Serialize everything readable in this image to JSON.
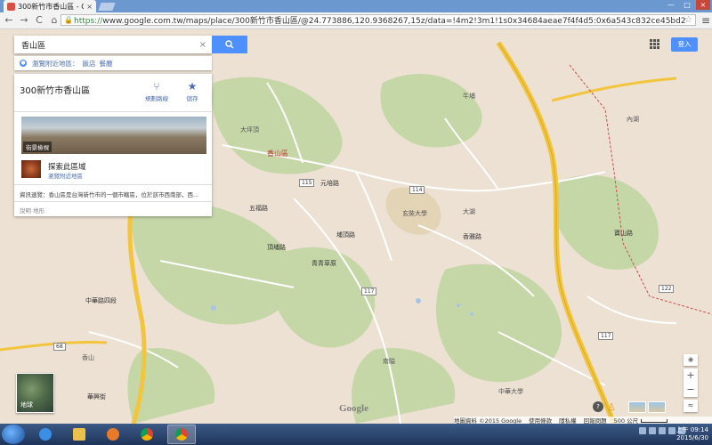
{
  "browser": {
    "tab_title": "300新竹市香山區 - Goog",
    "tab_close": "×",
    "url_scheme": "https://",
    "url_rest": "www.google.com.tw/maps/place/300新竹市香山區/@24.773886,120.9368267,15z/data=!4m2!3m1!1s0x34684aeae7f4f4d5:0x6a543c832ce45bd2",
    "back": "←",
    "forward": "→",
    "reload": "C",
    "home": "⌂",
    "star": "☆",
    "menu": "≡",
    "window_controls": [
      "—",
      "□",
      "×"
    ]
  },
  "search": {
    "value": "香山區",
    "clear": "×"
  },
  "nearby": {
    "label": "瀏覽附近地區：",
    "links": [
      "飯店",
      "餐廳"
    ]
  },
  "place": {
    "name": "300新竹市香山區",
    "actions": [
      {
        "label": "規劃路線",
        "icon": "⑂"
      },
      {
        "label": "儲存",
        "icon": "★"
      }
    ],
    "photo_tag": "街景檢視",
    "explore_title": "探索此區域",
    "explore_link": "瀏覽附近地區",
    "summary": "資訊速覽：香山區是台灣新竹市的一個市轄區，位於該市西南部，西...",
    "meta": "說明  地形"
  },
  "header": {
    "signin": "登入"
  },
  "map": {
    "labels": [
      {
        "text": "香山區",
        "style": "red"
      },
      {
        "text": "玄奘大學"
      },
      {
        "text": "中華大學"
      },
      {
        "text": "大坪頂"
      },
      {
        "text": "南隘"
      },
      {
        "text": "香山"
      },
      {
        "text": "牛埔"
      },
      {
        "text": "內湖"
      },
      {
        "text": "大湖"
      },
      {
        "text": "埔頂路"
      },
      {
        "text": "元培路"
      },
      {
        "text": "五福路"
      },
      {
        "text": "青青草原"
      },
      {
        "text": "頂埔路"
      },
      {
        "text": "香雅路"
      },
      {
        "text": "中華路四段"
      },
      {
        "text": "寶山路"
      },
      {
        "text": "華興街"
      }
    ],
    "shields": [
      "68",
      "117",
      "122"
    ],
    "route_labels": [
      "115",
      "117",
      "114"
    ],
    "earth_label": "地球",
    "compass": "◉",
    "zoom_in": "+",
    "zoom_out": "−",
    "help": "?",
    "pegman": "♙",
    "expand": "≈",
    "logo": "Google"
  },
  "footer": {
    "items": [
      "地圖資料 ©2015 Google",
      "使用條款",
      "隱私權",
      "回報問題",
      "500 公尺"
    ]
  },
  "taskbar": {
    "time": "上午 09:14",
    "date": "2015/6/30"
  },
  "colors": {
    "accent": "#4d90fe",
    "highway": "#f2c53d",
    "road": "#ffffff",
    "green": "#c5d7a7"
  }
}
